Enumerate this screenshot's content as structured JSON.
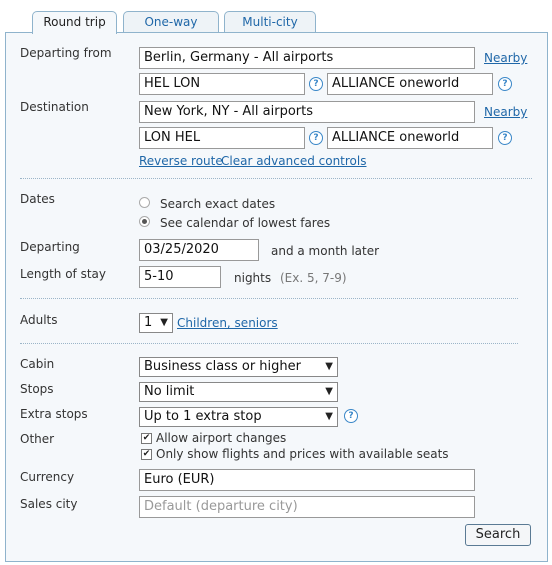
{
  "tabs": [
    {
      "label": "Round trip"
    },
    {
      "label": "One-way"
    },
    {
      "label": "Multi-city"
    }
  ],
  "origin": {
    "label": "Departing from",
    "value": "Berlin, Germany - All airports",
    "nearby": "Nearby",
    "codes": "HEL LON",
    "alliance": "ALLIANCE oneworld"
  },
  "destination": {
    "label": "Destination",
    "value": "New York, NY - All airports",
    "nearby": "Nearby",
    "codes": "LON HEL",
    "alliance": "ALLIANCE oneworld"
  },
  "links": {
    "reverse": "Reverse route",
    "clear": "Clear advanced controls"
  },
  "dates": {
    "label": "Dates",
    "exact": "Search exact dates",
    "calendar": "See calendar of lowest fares",
    "departing_label": "Departing",
    "departing_value": "03/25/2020",
    "departing_suffix": "and a month later",
    "stay_label": "Length of stay",
    "stay_value": "5-10",
    "stay_unit": "nights",
    "stay_hint": "(Ex. 5, 7-9)"
  },
  "adults": {
    "label": "Adults",
    "value": "1",
    "children_link": "Children, seniors"
  },
  "cabin": {
    "label": "Cabin",
    "value": "Business class or higher"
  },
  "stops": {
    "label": "Stops",
    "value": "No limit"
  },
  "extra_stops": {
    "label": "Extra stops",
    "value": "Up to 1 extra stop"
  },
  "other": {
    "label": "Other",
    "allow_changes": "Allow airport changes",
    "available_seats": "Only show flights and prices with available seats"
  },
  "currency": {
    "label": "Currency",
    "value": "Euro (EUR)"
  },
  "sales_city": {
    "label": "Sales city",
    "placeholder": "Default (departure city)"
  },
  "search_button": "Search"
}
